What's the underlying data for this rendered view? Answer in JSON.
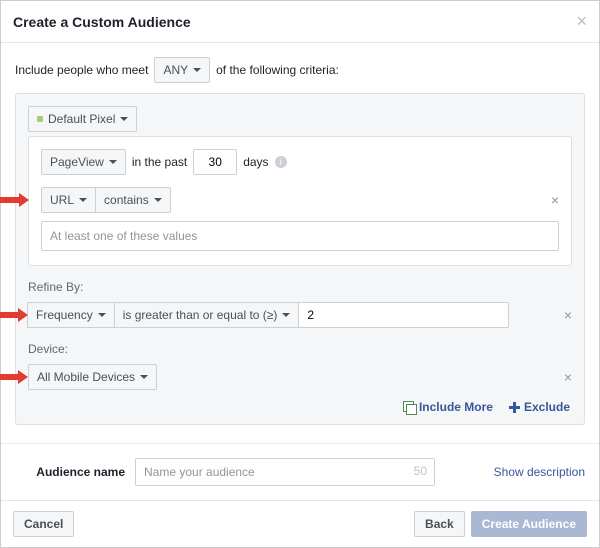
{
  "header": {
    "title": "Create a Custom Audience"
  },
  "intro": {
    "prefix": "Include people who meet",
    "any": "ANY",
    "suffix": "of the following criteria:"
  },
  "pixel": {
    "label": "Default Pixel"
  },
  "event": {
    "name": "PageView",
    "mid": "in the past",
    "days_value": "30",
    "days_label": "days"
  },
  "url": {
    "field": "URL",
    "op": "contains",
    "placeholder": "At least one of these values"
  },
  "refine": {
    "label": "Refine By:",
    "field": "Frequency",
    "op": "is greater than or equal to (≥)",
    "value": "2"
  },
  "device": {
    "label": "Device:",
    "value": "All Mobile Devices"
  },
  "links": {
    "include": "Include More",
    "exclude": "Exclude"
  },
  "name": {
    "label": "Audience name",
    "placeholder": "Name your audience",
    "count": "50",
    "show_desc": "Show description"
  },
  "footer": {
    "cancel": "Cancel",
    "back": "Back",
    "create": "Create Audience"
  }
}
